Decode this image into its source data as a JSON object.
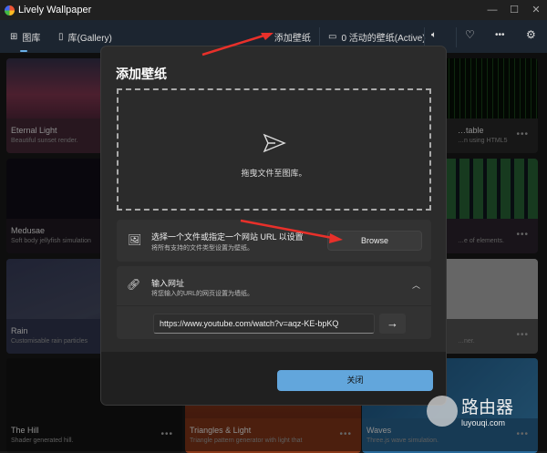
{
  "window": {
    "title": "Lively Wallpaper",
    "controls": [
      "—",
      "☐",
      "✕"
    ]
  },
  "nav": {
    "gallery_tab": "图库",
    "library_tab": "库(Gallery)",
    "add_wallpaper": "添加壁纸",
    "active_wallpapers": "0 活动的壁纸(Active)"
  },
  "cards": [
    {
      "title": "Eternal Light",
      "desc": "Beautiful sunset render."
    },
    {
      "title": "…table",
      "desc": "…n using HTML5"
    },
    {
      "title": "Medusae",
      "desc": "Soft body jellyfish simulation"
    },
    {
      "title": "",
      "desc": "…e of elements."
    },
    {
      "title": "Rain",
      "desc": "Customisable rain particles"
    },
    {
      "title": "",
      "desc": "…ner."
    },
    {
      "title": "The Hill",
      "desc": "Shader generated hill."
    },
    {
      "title": "Triangles & Light",
      "desc": "Triangle pattern generator with light that"
    },
    {
      "title": "Waves",
      "desc": "Three.js wave simulation."
    }
  ],
  "dialog": {
    "title": "添加壁纸",
    "drop_label": "拖曳文件至图库。",
    "file": {
      "heading": "选择一个文件或指定一个网站 URL 以设置",
      "sub": "将所有支持的文件类型设置为壁纸。",
      "button": "Browse"
    },
    "url": {
      "heading": "输入网址",
      "sub": "将您输入的URL的网页设置为墙纸。",
      "value": "https://www.youtube.com/watch?v=aqz-KE-bpKQ",
      "go": "→"
    },
    "close": "关闭"
  },
  "watermark": {
    "brand": "路由器",
    "site": "luyouqi.com"
  },
  "colors": {
    "accent": "#62a6dc",
    "annotation": "#e8302a"
  }
}
